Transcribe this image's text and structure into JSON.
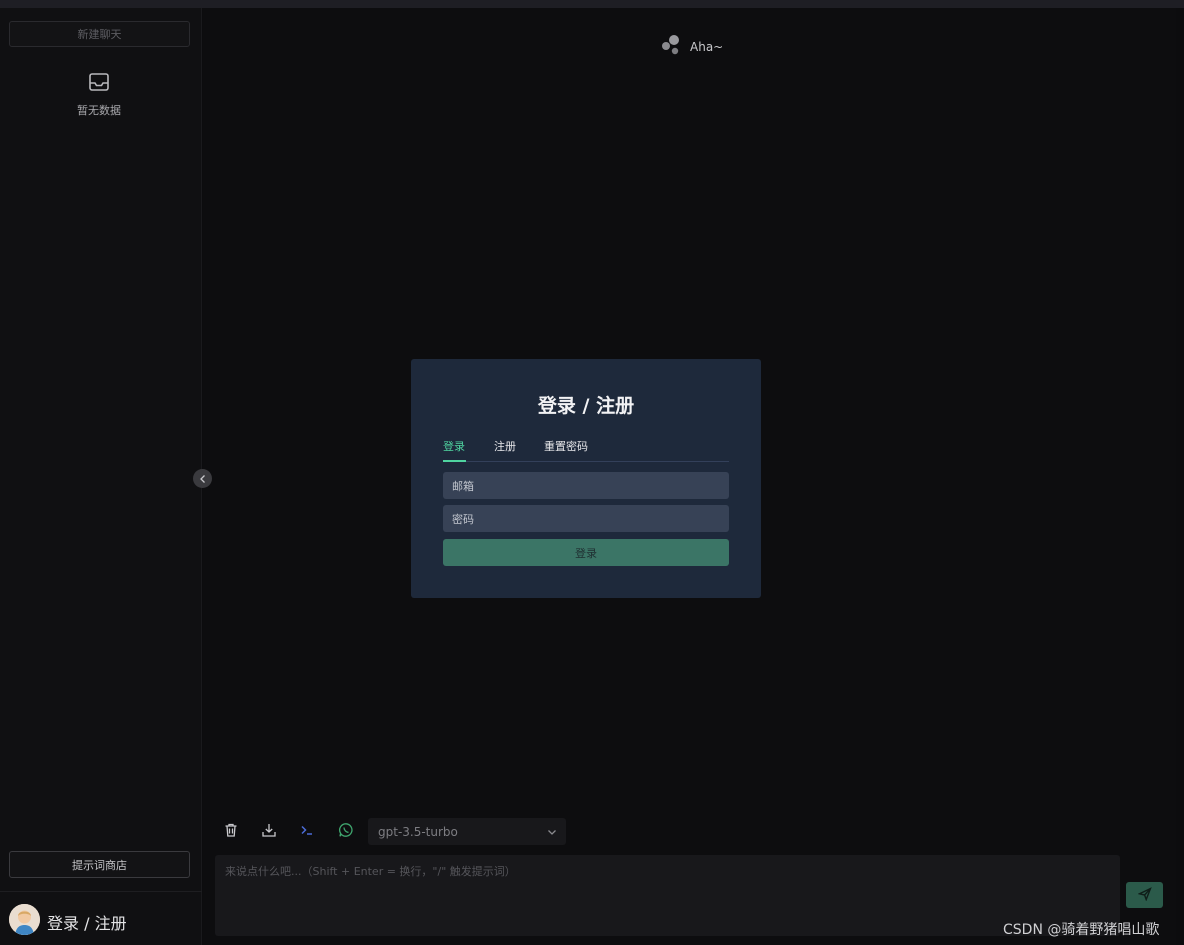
{
  "sidebar": {
    "new_chat_label": "新建聊天",
    "empty_text": "暂无数据",
    "prompt_store_label": "提示词商店",
    "user_label": "登录 / 注册"
  },
  "brand": {
    "name": "Aha~"
  },
  "modal": {
    "title": "登录 / 注册",
    "tabs": [
      {
        "label": "登录",
        "active": true
      },
      {
        "label": "注册",
        "active": false
      },
      {
        "label": "重置密码",
        "active": false
      }
    ],
    "email_placeholder": "邮箱",
    "password_placeholder": "密码",
    "submit_label": "登录"
  },
  "toolbar": {
    "model_selected": "gpt-3.5-turbo",
    "icons": [
      "trash-icon",
      "download-icon",
      "terminal-icon",
      "whatsapp-icon"
    ]
  },
  "composer": {
    "placeholder": "来说点什么吧...（Shift + Enter = 换行，\"/\" 触发提示词）"
  },
  "watermark": "CSDN @骑着野猪唱山歌",
  "colors": {
    "accent": "#4fd4a0",
    "modal_bg": "#1e293b",
    "primary_button": "#3b7566",
    "send_button": "#2b5a4a",
    "terminal_icon": "#4b6bd6",
    "whatsapp_icon": "#3fa56e"
  }
}
